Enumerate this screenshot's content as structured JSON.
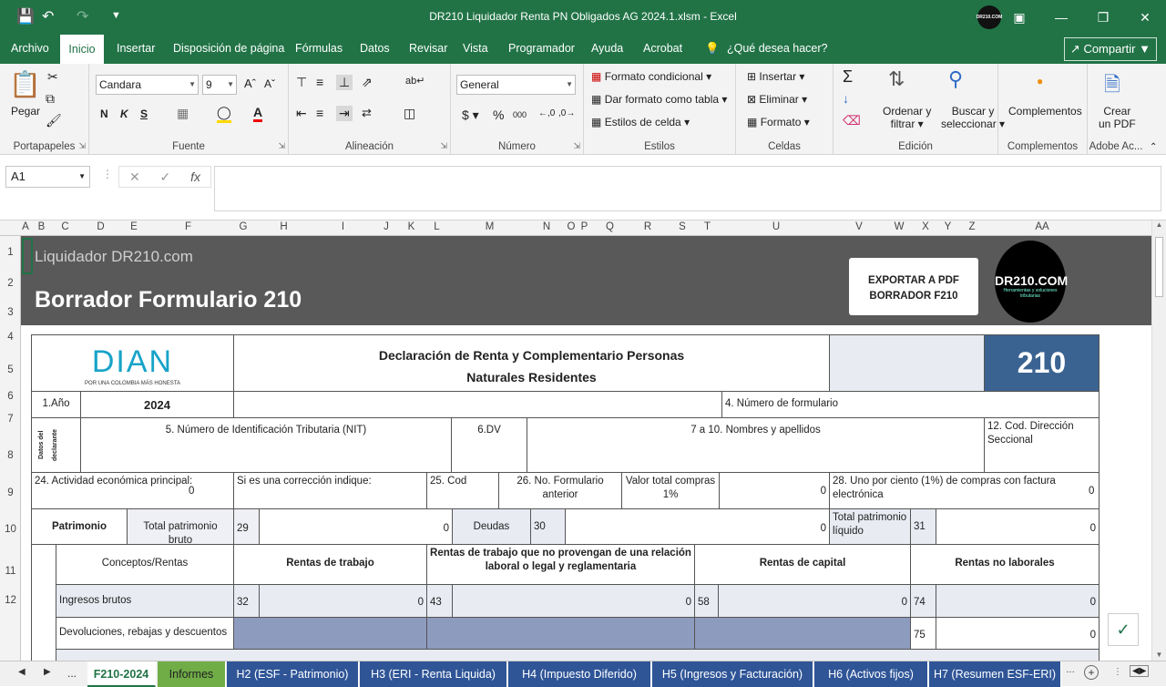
{
  "titlebar": {
    "title": "DR210 Liquidador Renta PN Obligados AG 2024.1.xlsm  -  Excel",
    "avatar_text": "DR210.COM"
  },
  "menu": {
    "items": [
      "Archivo",
      "Inicio",
      "Insertar",
      "Disposición de página",
      "Fórmulas",
      "Datos",
      "Revisar",
      "Vista",
      "Programador",
      "Ayuda",
      "Acrobat"
    ],
    "tell_me": "¿Qué desea hacer?",
    "share": "Compartir"
  },
  "ribbon": {
    "portapapeles": {
      "paste": "Pegar",
      "label": "Portapapeles"
    },
    "fuente": {
      "font": "Candara",
      "size": "9",
      "bold": "N",
      "italic": "K",
      "underline": "S",
      "label": "Fuente"
    },
    "alineacion": {
      "label": "Alineación"
    },
    "numero": {
      "format": "General",
      "label": "Número"
    },
    "estilos": {
      "cond": "Formato condicional",
      "table": "Dar formato como tabla",
      "cell": "Estilos de celda",
      "label": "Estilos"
    },
    "celdas": {
      "insert": "Insertar",
      "delete": "Eliminar",
      "format": "Formato",
      "label": "Celdas"
    },
    "edicion": {
      "sort1": "Ordenar y",
      "sort2": "filtrar",
      "find1": "Buscar y",
      "find2": "seleccionar",
      "label": "Edición"
    },
    "complementos": {
      "btn": "Complementos",
      "label": "Complementos"
    },
    "adobe": {
      "btn1": "Crear",
      "btn2": "un PDF",
      "label": "Adobe Ac..."
    }
  },
  "formula_bar": {
    "name_box": "A1",
    "formula": ""
  },
  "columns": [
    "A",
    "B",
    "C",
    "D",
    "E",
    "F",
    "G",
    "H",
    "I",
    "J",
    "K",
    "L",
    "M",
    "N",
    "O",
    "P",
    "Q",
    "R",
    "S",
    "T",
    "U",
    "V",
    "W",
    "X",
    "Y",
    "Z",
    "AA"
  ],
  "rows": [
    "1",
    "2",
    "3",
    "4",
    "5",
    "6",
    "7",
    "8",
    "9",
    "10",
    "11",
    "12"
  ],
  "sheet": {
    "brand": "Liquidador DR210.com",
    "heading": "Borrador Formulario 210",
    "export_btn1": "EXPORTAR A PDF",
    "export_btn2": "BORRADOR F210",
    "logo_text": "DR210.COM",
    "logo_sub": "Herramientas y soluciones tributarias",
    "dian": "DIAN",
    "dian_tag": "POR UNA COLOMBIA MÁS HONESTA",
    "form_title1": "Declaración de Renta y Complementario Personas",
    "form_title2": "Naturales Residentes",
    "form_number": "210",
    "anio_label": "1.Año",
    "anio": "2024",
    "num_formulario": "4. Número de formulario",
    "datos_declarante": "Datos del declarante",
    "nit": "5. Número de Identificación Tributaria (NIT)",
    "dv": "6.DV",
    "nombres": "7 a 10. Nombres y apellidos",
    "cod_dir": "12. Cod. Dirección Seccional",
    "actividad": "24. Actividad económica principal:",
    "actividad_val": "0",
    "correccion": "Si es una corrección indique:",
    "cod25": "25. Cod",
    "no_form": "26. No. Formulario anterior",
    "valor_compras": "Valor total compras 1%",
    "valor_compras_val": "0",
    "uno_por_ciento": "28. Uno por ciento (1%) de compras con factura electrónica",
    "uno_val": "0",
    "patrimonio": "Patrimonio",
    "total_bruto": "Total patrimonio bruto",
    "c29": "29",
    "v29": "0",
    "deudas": "Deudas",
    "c30": "30",
    "v30": "0",
    "total_liquido": "Total patrimonio líquido",
    "c31": "31",
    "v31": "0",
    "conceptos": "Conceptos/Rentas",
    "rentas_trabajo": "Rentas de trabajo",
    "rentas_no_rel": "Rentas de trabajo que no provengan de una relación laboral o legal y reglamentaria",
    "rentas_capital": "Rentas de capital",
    "rentas_no_lab": "Rentas no laborales",
    "ingresos": "Ingresos brutos",
    "c32": "32",
    "v32": "0",
    "c43": "43",
    "v43": "0",
    "c58": "58",
    "v58": "0",
    "c74": "74",
    "v74": "0",
    "devoluciones": "Devoluciones, rebajas y descuentos",
    "c75": "75",
    "v75": "0"
  },
  "tabs": [
    "F210-2024",
    "Informes",
    "H2 (ESF - Patrimonio)",
    "H3 (ERI - Renta Liquida)",
    "H4 (Impuesto Diferido)",
    "H5 (Ingresos y Facturación)",
    "H6 (Activos fijos)",
    "H7 (Resumen ESF-ERI)"
  ],
  "tab_nav": "..."
}
